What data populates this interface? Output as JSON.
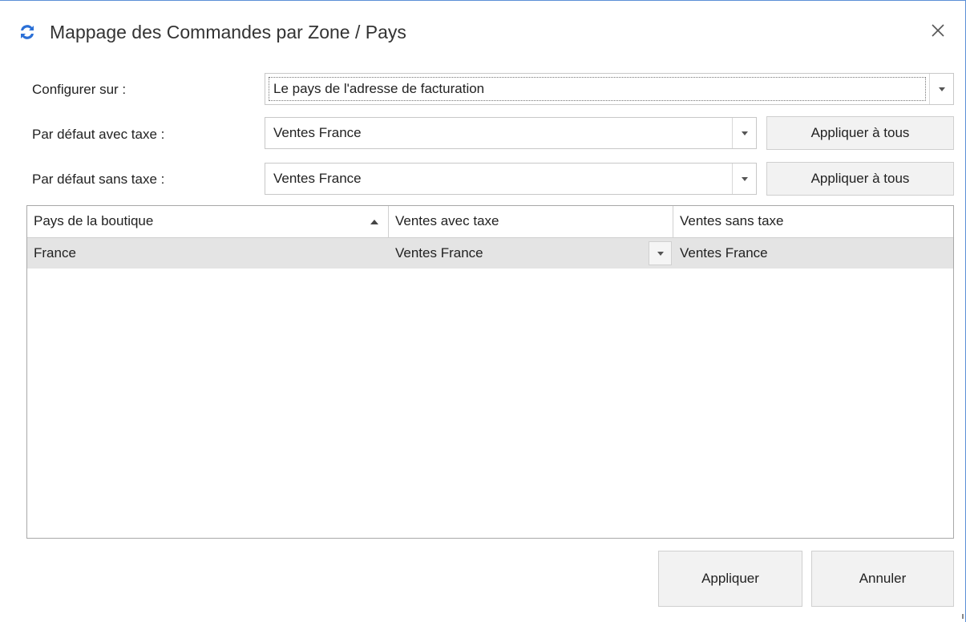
{
  "window": {
    "title": "Mappage des Commandes par Zone / Pays",
    "icon": "sync-icon",
    "accent_color": "#2a6fd6"
  },
  "form": {
    "configure_label": "Configurer sur :",
    "configure_value": "Le pays de l'adresse de facturation",
    "default_tax_label": "Par défaut avec taxe :",
    "default_tax_value": "Ventes France",
    "default_notax_label": "Par défaut sans taxe :",
    "default_notax_value": "Ventes France",
    "apply_all_label": "Appliquer à tous"
  },
  "grid": {
    "columns": [
      "Pays de la boutique",
      "Ventes avec taxe",
      "Ventes sans taxe"
    ],
    "sort_column": "Pays de la boutique",
    "sort_direction": "ascending",
    "rows": [
      [
        "France",
        "Ventes France",
        "Ventes France"
      ]
    ]
  },
  "footer": {
    "apply_label": "Appliquer",
    "cancel_label": "Annuler"
  }
}
